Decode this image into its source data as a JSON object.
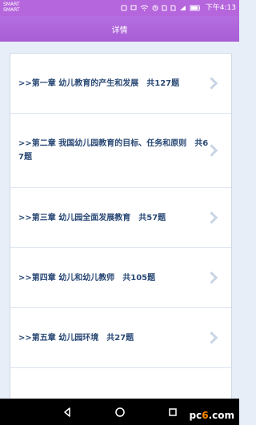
{
  "status_bar": {
    "carrier_1": "SMART",
    "carrier_2": "SMART",
    "time": "下午4:13"
  },
  "header": {
    "title": "详情"
  },
  "chapters": [
    ">>第一章 幼儿教育的产生和发展　共127题",
    ">>第二章 我国幼儿园教育的目标、任务和原则　共67题",
    ">>第三章 幼儿园全面发展教育　共57题",
    ">>第四章 幼儿和幼儿教师　共105题",
    ">>第五章 幼儿园环境　共27题"
  ],
  "watermark": {
    "pc": "pc",
    "six": "6",
    "tail": ".com"
  },
  "colors": {
    "header": "#a85dd6",
    "text": "#2b4a76"
  }
}
